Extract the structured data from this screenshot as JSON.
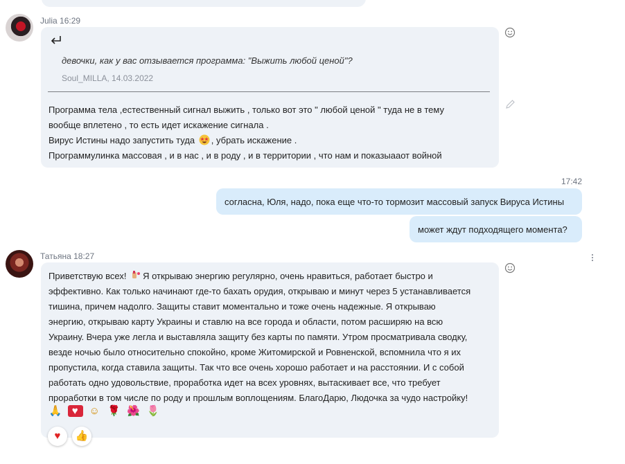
{
  "messages": {
    "julia": {
      "sender": "Julia",
      "time": "16:29",
      "quote": {
        "text": "девочки, как у вас отзывается программа:  \"Выжить любой ценой\"?",
        "source": "Soul_MILLA, 14.03.2022"
      },
      "lines": [
        "Программа тела ,естественный сигнал выжить , только вот это \" любой ценой \" туда не в тему",
        "вообще вплетено , то есть идет искажение сигнала .",
        "Вирус Истины надо запустить туда",
        ", убрать искажение .",
        "Программулинка массовая , и в нас , и в роду , и в территории , что нам и показыааот войной"
      ],
      "inline_emoji": "star-struck-emoji"
    },
    "me": {
      "time": "17:42",
      "bubbles": [
        "согласна, Юля, надо, пока еще что-то тормозит массовый запуск Вируса Истины",
        "может ждут подходящего момента?"
      ]
    },
    "tatyana": {
      "sender": "Татьяна",
      "time": "18:27",
      "first_line_start": "Приветствую всех!",
      "first_line_end": "Я открываю энергию регулярно, очень нравиться, работает быстро и",
      "lines": [
        "эффективно. Как только начинают где-то бахать орудия, открываю и минут через 5 устанавливается",
        "тишина, причем надолго. Защиты ставит моментально и тоже очень надежные. Я открываю",
        "энергию, открываю карту Украины и ставлю на все города и области, потом расширяю на всю",
        "Украину. Вчера уже легла и выставляла защиту без карты по памяти. Утром просматривала сводку,",
        "везде ночью было относительно спокойно, кроме Житомирской и Ровненской, вспомнила что я их",
        "пропустила, когда ставила защиты. Так что все очень хорошо работает и на расстоянии. И с собой",
        "работать одно удовольствие, проработка идет на всех уровнях, вытаскивает все, что требует",
        "проработки в том числе по роду и прошлым воплощениям. БлагоДарю, Людочка за чудо настройку!"
      ],
      "emojis": [
        "🙏",
        "♥",
        "☺",
        "🌹",
        "🌺",
        "🌷"
      ],
      "reactions": {
        "heart": "♥",
        "like": "👍"
      }
    }
  },
  "icons": {
    "reply": "reply-arrow-icon",
    "emoji_picker": "smiley-icon",
    "edit": "pencil-icon",
    "more": "more-options-icon"
  }
}
